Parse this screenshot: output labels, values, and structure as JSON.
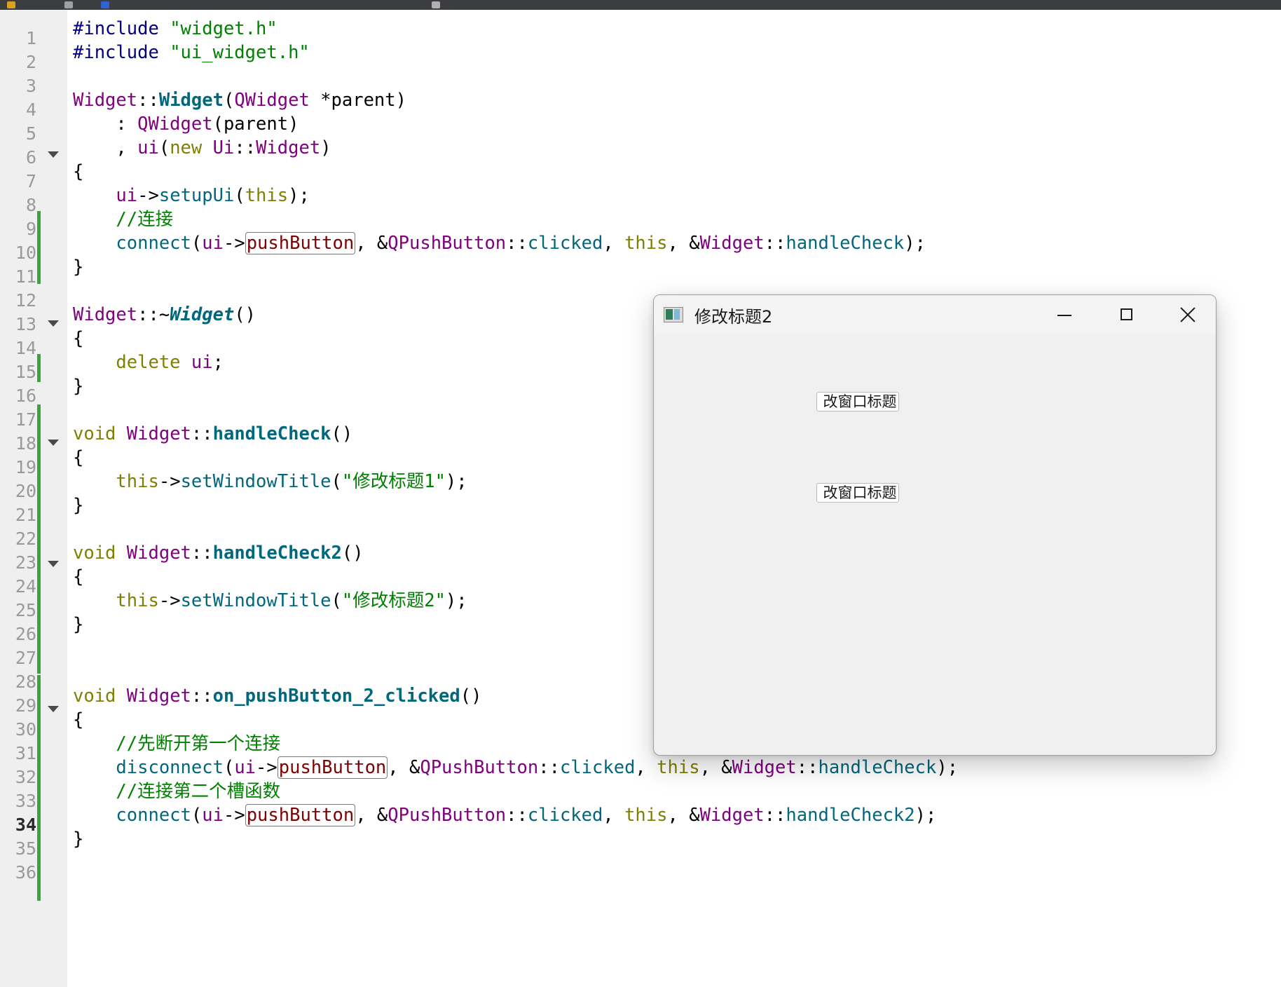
{
  "editor": {
    "line_numbers": [
      "1",
      "2",
      "3",
      "4",
      "5",
      "6",
      "7",
      "8",
      "9",
      "10",
      "11",
      "12",
      "13",
      "14",
      "15",
      "16",
      "17",
      "18",
      "19",
      "20",
      "21",
      "22",
      "23",
      "24",
      "25",
      "26",
      "27",
      "28",
      "29",
      "30",
      "31",
      "32",
      "33",
      "34",
      "35",
      "36"
    ],
    "current_line": "34",
    "code": {
      "l1": [
        "#include",
        " ",
        "\"widget.h\""
      ],
      "l2": [
        "#include",
        " ",
        "\"ui_widget.h\""
      ],
      "l4": [
        "Widget",
        "::",
        "Widget",
        "(",
        "QWidget",
        " *",
        "parent",
        ")"
      ],
      "l5": [
        "    : ",
        "QWidget",
        "(",
        "parent",
        ")"
      ],
      "l6": [
        "    , ",
        "ui",
        "(",
        "new",
        " ",
        "Ui",
        "::",
        "Widget",
        ")"
      ],
      "l7": "{",
      "l8": [
        "    ",
        "ui",
        "->",
        "setupUi",
        "(",
        "this",
        ");"
      ],
      "l9": "    //连接",
      "l10": [
        "    ",
        "connect",
        "(",
        "ui",
        "->",
        "pushButton",
        ", &",
        "QPushButton",
        "::",
        "clicked",
        ", ",
        "this",
        ", &",
        "Widget",
        "::",
        "handleCheck",
        ");"
      ],
      "l11": "}",
      "l13": [
        "Widget",
        "::~",
        "Widget",
        "()"
      ],
      "l14": "{",
      "l15": [
        "    ",
        "delete",
        " ",
        "ui",
        ";"
      ],
      "l16": "}",
      "l18": [
        "void",
        " ",
        "Widget",
        "::",
        "handleCheck",
        "()"
      ],
      "l19": "{",
      "l20": [
        "    ",
        "this",
        "->",
        "setWindowTitle",
        "(",
        "\"修改标题1\"",
        ");"
      ],
      "l21": "}",
      "l23": [
        "void",
        " ",
        "Widget",
        "::",
        "handleCheck2",
        "()"
      ],
      "l24": "{",
      "l25": [
        "    ",
        "this",
        "->",
        "setWindowTitle",
        "(",
        "\"修改标题2\"",
        ");"
      ],
      "l26": "}",
      "l29": [
        "void",
        " ",
        "Widget",
        "::",
        "on_pushButton_2_clicked",
        "()"
      ],
      "l30": "{",
      "l31": "    //先断开第一个连接",
      "l32": [
        "    ",
        "disconnect",
        "(",
        "ui",
        "->",
        "pushButton",
        ", &",
        "QPushButton",
        "::",
        "clicked",
        ", ",
        "this",
        ", &",
        "Widget",
        "::",
        "handleCheck",
        ");"
      ],
      "l33": "    //连接第二个槽函数",
      "l34": [
        "    ",
        "connect",
        "(",
        "ui",
        "->",
        "pushButton",
        ", &",
        "QPushButton",
        "::",
        "clicked",
        ", ",
        "this",
        ", &",
        "Widget",
        "::",
        "handleCheck2",
        ");"
      ],
      "l35": "}"
    }
  },
  "dialog": {
    "title": "修改标题2",
    "button1_label": "改窗口标题",
    "button2_label": "改窗口标题"
  },
  "icons": [
    "app-window-icon",
    "minimize-icon",
    "maximize-icon",
    "close-icon",
    "fold-arrow-icon"
  ]
}
